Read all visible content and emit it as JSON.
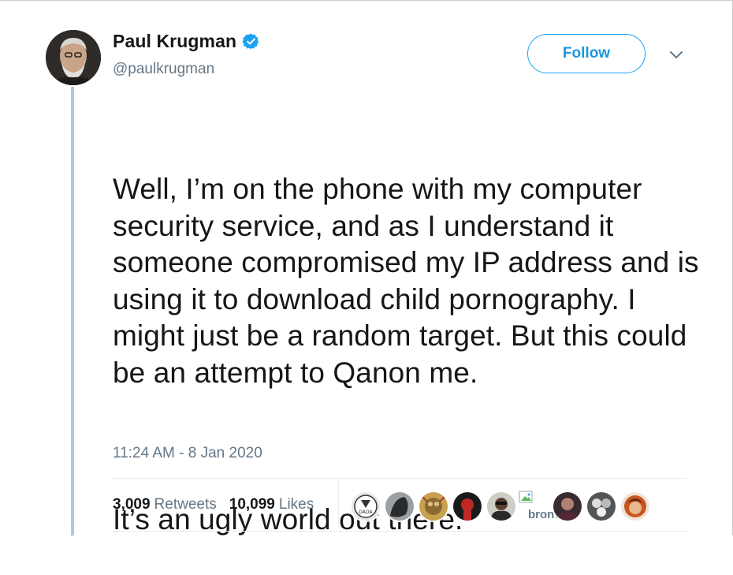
{
  "tweet": {
    "author": {
      "name": "Paul Krugman",
      "handle": "@paulkrugman",
      "verified": true,
      "avatar_icon": "profile-photo"
    },
    "follow_label": "Follow",
    "paragraphs": [
      "Well, I’m on the phone with my computer security service, and as I understand it someone compromised my IP address and is using it to download child pornography. I might just be a random target. But this could be an attempt to Qanon me.",
      "It’s an ugly world out there."
    ],
    "timestamp": "11:24 AM - 8 Jan 2020",
    "stats": {
      "retweets_count": "3,009",
      "retweets_label": "Retweets",
      "likes_count": "10,099",
      "likes_label": "Likes"
    },
    "likers": [
      {
        "icon": "dada-logo-avatar"
      },
      {
        "icon": "dark-avatar"
      },
      {
        "icon": "colorful-avatar"
      },
      {
        "icon": "dark-red-avatar"
      },
      {
        "icon": "person-avatar"
      },
      {
        "icon": "broken-image-avatar",
        "alt": "bronwen"
      },
      {
        "icon": "person-avatar"
      },
      {
        "icon": "bw-avatar"
      },
      {
        "icon": "orange-avatar"
      }
    ]
  },
  "colors": {
    "accent": "#1da1f2",
    "thread_line": "#9ed0e0",
    "secondary_text": "#657786"
  }
}
